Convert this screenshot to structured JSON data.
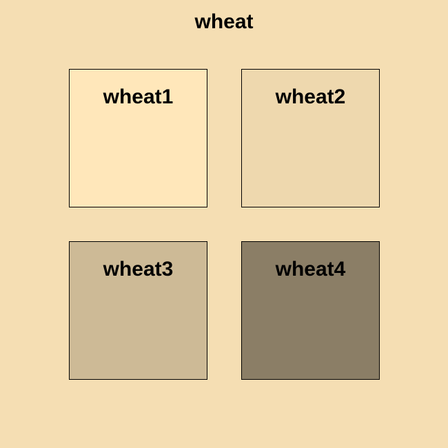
{
  "page": {
    "title": "wheat",
    "background": "#F5DEB3"
  },
  "swatches": [
    {
      "label": "wheat1",
      "color": "#FFE7BA"
    },
    {
      "label": "wheat2",
      "color": "#EED8AE"
    },
    {
      "label": "wheat3",
      "color": "#CDBA96"
    },
    {
      "label": "wheat4",
      "color": "#8B7E66"
    }
  ]
}
